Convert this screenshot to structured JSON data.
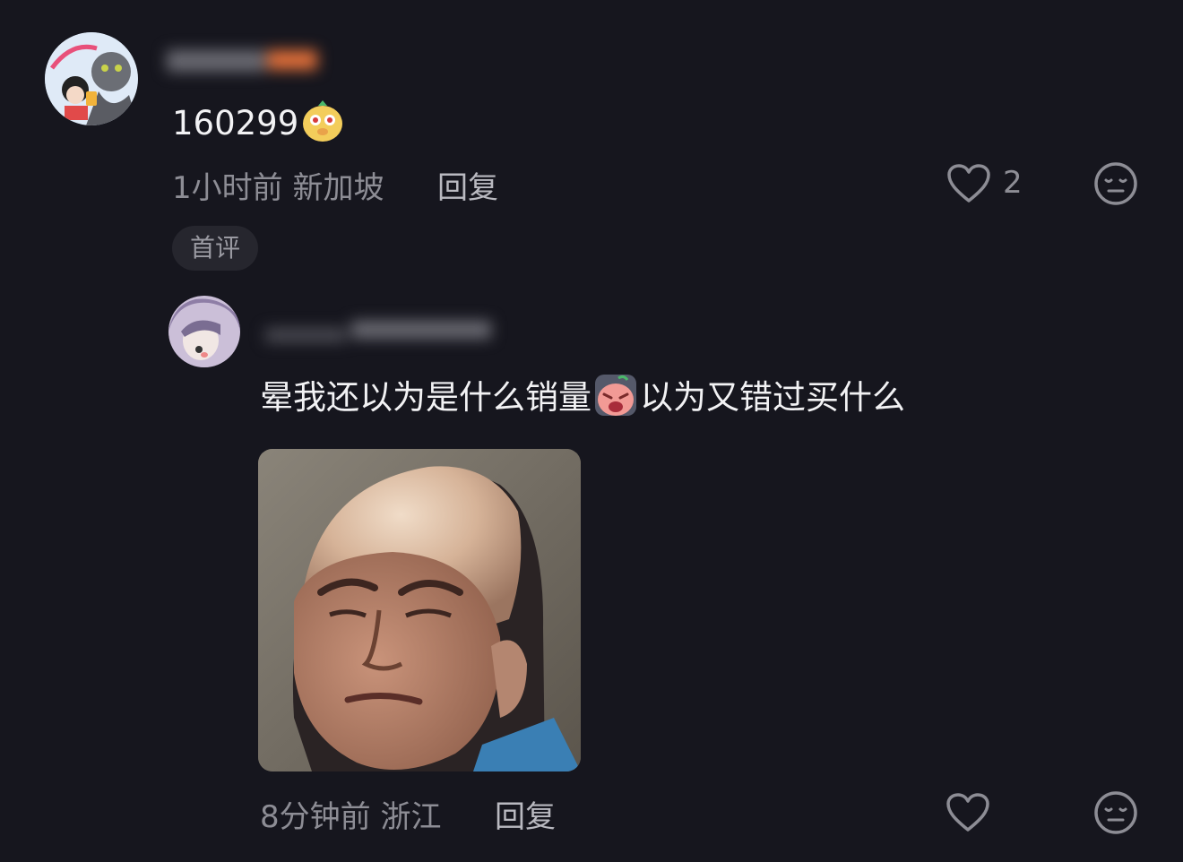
{
  "comment": {
    "text": "160299",
    "emoji_icon": "mole-emoji-icon",
    "time": "1小时前",
    "location": "新加坡",
    "reply_label": "回复",
    "like_count": "2",
    "badge": "首评"
  },
  "reply": {
    "text_part1": "晕我还以为是什么销量",
    "emoji_icon": "crying-face-emoji-icon",
    "text_part2": "以为又错过买什么",
    "time": "8分钟前",
    "location": "浙江",
    "reply_label": "回复"
  },
  "icons": {
    "like": "heart-outline-icon",
    "dislike": "meh-face-icon"
  },
  "colors": {
    "background": "#16161e",
    "text": "#f2f2f4",
    "meta": "#8d8d95",
    "badge_bg": "#26262e"
  }
}
